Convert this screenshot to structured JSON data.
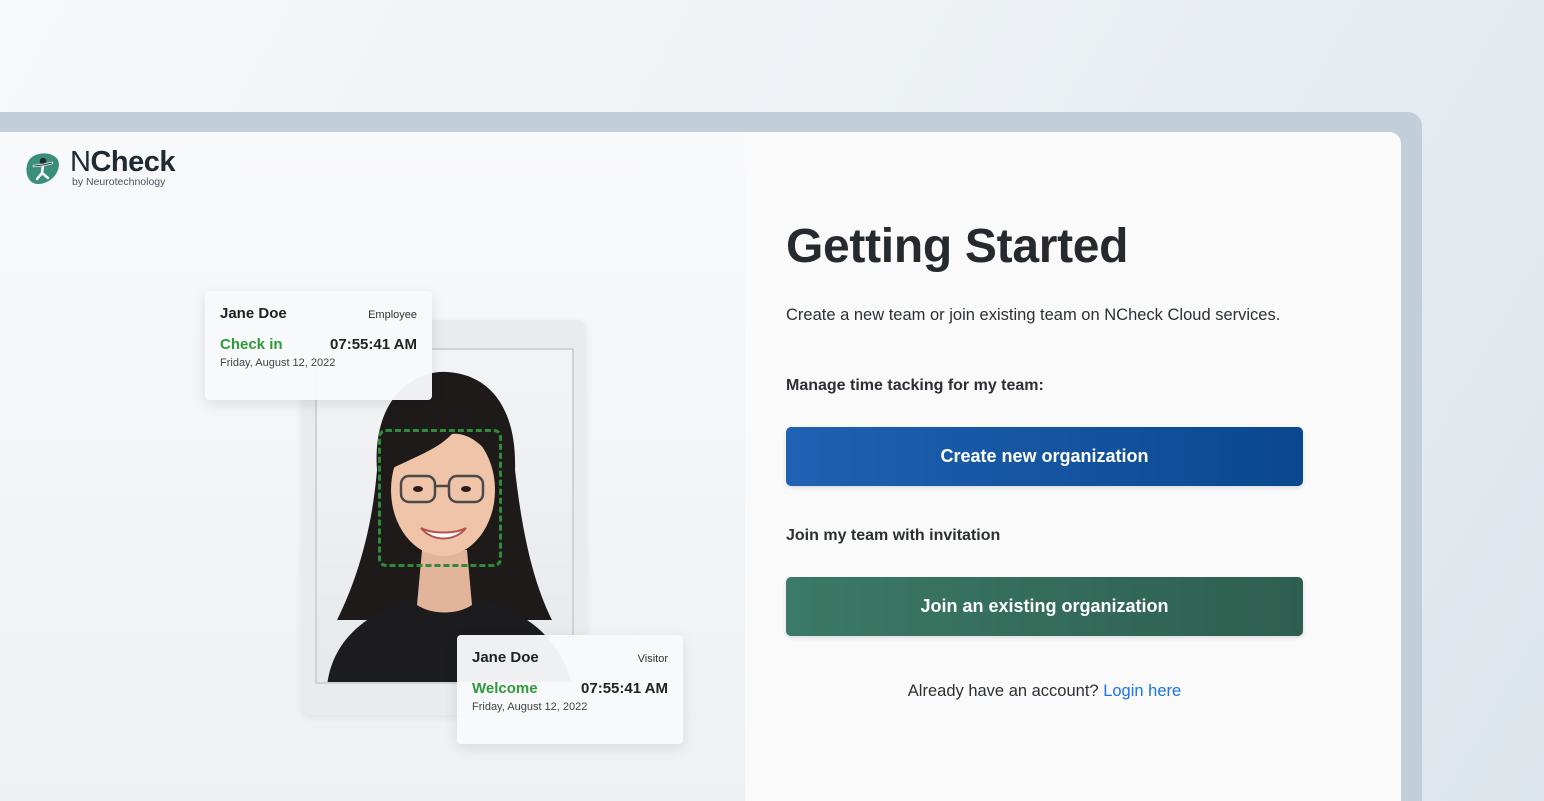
{
  "brand": {
    "name_light": "N",
    "name_bold": "Check",
    "sub": "by Neurotechnology"
  },
  "illustration": {
    "employee_card": {
      "name": "Jane Doe",
      "role": "Employee",
      "status": "Check in",
      "time": "07:55:41 AM",
      "date": "Friday, August 12, 2022"
    },
    "visitor_card": {
      "name": "Jane Doe",
      "role": "Visitor",
      "status": "Welcome",
      "time": "07:55:41 AM",
      "date": "Friday, August 12, 2022"
    }
  },
  "main": {
    "title": "Getting Started",
    "subtitle": "Create a new team or join existing team on NCheck Cloud services.",
    "manage_label": "Manage time tacking for my team:",
    "create_button": "Create new organization",
    "join_label": "Join my team with invitation",
    "join_button": "Join an existing organization",
    "login_prompt": "Already have an account?",
    "login_link": "Login here"
  },
  "colors": {
    "create_button": "#1f62b3",
    "join_button": "#3b7a66",
    "link": "#1a73e8",
    "status_green": "#2e9a3a"
  }
}
